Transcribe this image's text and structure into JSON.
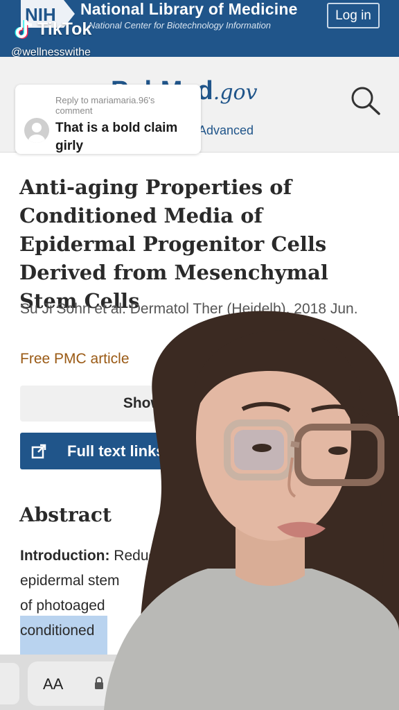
{
  "header": {
    "logo_text": "NIH",
    "title": "National Library of Medicine",
    "subtitle": "National Center for Biotechnology Information",
    "login_label": "Log in"
  },
  "tiktok": {
    "brand": "TikTok",
    "handle": "@wellnesswithe"
  },
  "pubmed": {
    "logo_text": "PubMed",
    "logo_suffix": ".gov",
    "advanced_link": "Advanced"
  },
  "reply": {
    "reply_to": "Reply to mariamaria.96's comment",
    "comment": "That is a bold claim girly"
  },
  "article": {
    "title": "Anti-aging Properties of Conditioned Media of Epidermal Progenitor Cells Derived from Mesenchymal Stem Cells",
    "citation": "Su Ji Sohn et al. Dermatol Ther (Heidelb). 2018 Jun.",
    "free_pmc": "Free PMC article",
    "show_details": "Show details",
    "full_text_links": "Full text links",
    "cite_glyph": "“"
  },
  "abstract": {
    "heading": "Abstract",
    "intro_label": "Introduction:",
    "line1_rest": " Reduced p",
    "line2": "epidermal stem",
    "line3": "of photoaged",
    "line4": "conditioned"
  },
  "safari": {
    "aa_label": "AA"
  },
  "colors": {
    "nih_blue": "#20558a",
    "pmc_orange": "#9a5a15",
    "highlight": "#b9d3ef"
  }
}
